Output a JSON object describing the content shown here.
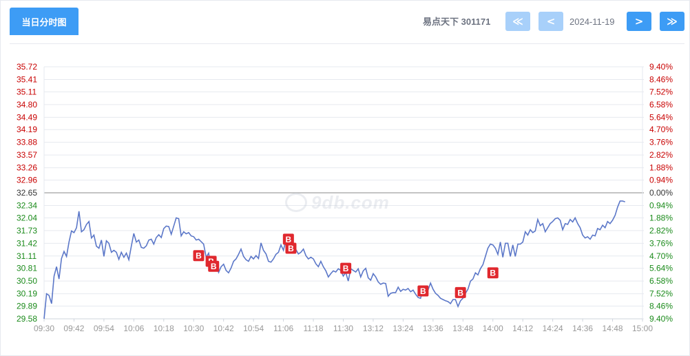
{
  "tab": {
    "label": "当日分时图"
  },
  "stock": {
    "name": "易点天下",
    "code": "301171"
  },
  "date": "2024-11-19",
  "nav": {
    "first": "≪",
    "prev": "<",
    "next": ">",
    "last": "≫"
  },
  "watermark": {
    "text": "9db.com"
  },
  "colors": {
    "line": "#5b77c8",
    "up": "#c80000",
    "down": "#1a8a1a",
    "base": "#333333",
    "grid": "#e6e9ef",
    "axis": "#999999",
    "marker": "#e0282e",
    "accent": "#3d9cf5"
  },
  "chart_data": {
    "type": "line",
    "base_price": 32.65,
    "y_ticks": [
      "35.72",
      "35.41",
      "35.11",
      "34.80",
      "34.49",
      "34.19",
      "33.88",
      "33.57",
      "33.26",
      "32.96",
      "32.65",
      "32.34",
      "32.04",
      "31.73",
      "31.42",
      "31.11",
      "30.81",
      "30.50",
      "30.19",
      "29.89",
      "29.58"
    ],
    "pct_ticks": [
      "9.40%",
      "8.46%",
      "7.52%",
      "6.58%",
      "5.64%",
      "4.70%",
      "3.76%",
      "2.82%",
      "1.88%",
      "0.94%",
      "0.00%",
      "0.94%",
      "1.88%",
      "2.82%",
      "3.76%",
      "4.70%",
      "5.64%",
      "6.58%",
      "7.52%",
      "8.46%",
      "9.40%"
    ],
    "x_ticks": [
      "09:30",
      "09:42",
      "09:54",
      "10:06",
      "10:18",
      "10:30",
      "10:42",
      "10:54",
      "11:06",
      "11:18",
      "11:30",
      "13:12",
      "13:24",
      "13:36",
      "13:48",
      "14:00",
      "14:12",
      "14:24",
      "14:36",
      "14:48",
      "15:00"
    ],
    "ylim": [
      29.58,
      35.72
    ],
    "session_minutes": 240,
    "x": [
      0,
      1,
      2,
      3,
      4,
      5,
      6,
      7,
      8,
      9,
      10,
      11,
      12,
      13,
      14,
      15,
      16,
      17,
      18,
      19,
      20,
      21,
      22,
      23,
      24,
      25,
      26,
      27,
      28,
      29,
      30,
      31,
      32,
      33,
      34,
      35,
      36,
      37,
      38,
      39,
      40,
      41,
      42,
      43,
      44,
      45,
      46,
      47,
      48,
      49,
      50,
      51,
      52,
      53,
      54,
      55,
      56,
      57,
      58,
      59,
      60,
      61,
      62,
      63,
      64,
      65,
      66,
      67,
      68,
      69,
      70,
      71,
      72,
      73,
      74,
      75,
      76,
      77,
      78,
      79,
      80,
      81,
      82,
      83,
      84,
      85,
      86,
      87,
      88,
      89,
      90,
      91,
      92,
      93,
      94,
      95,
      96,
      97,
      98,
      99,
      100,
      101,
      102,
      103,
      104,
      105,
      106,
      107,
      108,
      109,
      110,
      111,
      112,
      113,
      114,
      115,
      116,
      117,
      118,
      119,
      120,
      121,
      122,
      123,
      124,
      125,
      126,
      127,
      128,
      129,
      130,
      131,
      132,
      133,
      134,
      135,
      136,
      137,
      138,
      139,
      140,
      141,
      142,
      143,
      144,
      145,
      146,
      147,
      148,
      149,
      150,
      151,
      152,
      153,
      154,
      155,
      156,
      157,
      158,
      159,
      160,
      161,
      162,
      163,
      164,
      165,
      166,
      167,
      168,
      169,
      170,
      171,
      172,
      173,
      174,
      175,
      176,
      177,
      178,
      179,
      180,
      181,
      182,
      183,
      184,
      185,
      186,
      187,
      188,
      189,
      190,
      191,
      192,
      193,
      194,
      195,
      196,
      197,
      198,
      199,
      200,
      201,
      202,
      203,
      204,
      205,
      206,
      207,
      208,
      209,
      210,
      211,
      212,
      213,
      214,
      215,
      216,
      217,
      218,
      219,
      220,
      221,
      222,
      223,
      224,
      225,
      226,
      227,
      228,
      229,
      230,
      231,
      232,
      233,
      234,
      235,
      236,
      237,
      238,
      239,
      240
    ],
    "series": [
      {
        "values": [
          29.58,
          30.19,
          30.15,
          29.95,
          30.62,
          30.85,
          30.55,
          31.05,
          31.22,
          31.1,
          31.45,
          31.72,
          31.68,
          31.8,
          32.2,
          31.7,
          31.75,
          31.88,
          31.95,
          31.55,
          31.62,
          31.35,
          31.3,
          31.5,
          31.1,
          31.48,
          31.42,
          31.2,
          31.25,
          31.2,
          31.03,
          31.2,
          31.08,
          31.18,
          31.02,
          31.35,
          31.66,
          31.45,
          31.5,
          31.32,
          31.3,
          31.36,
          31.5,
          31.52,
          31.4,
          31.56,
          31.63,
          31.56,
          31.78,
          31.84,
          31.83,
          31.64,
          31.84,
          32.04,
          32.02,
          31.6,
          31.7,
          31.65,
          31.68,
          31.6,
          31.58,
          31.5,
          31.52,
          31.46,
          31.4,
          31.08,
          31.18,
          30.81,
          30.95,
          30.88,
          30.71,
          30.85,
          30.91,
          30.76,
          30.7,
          30.82,
          30.98,
          31.04,
          31.15,
          31.28,
          31.1,
          31.02,
          30.98,
          31.1,
          31.04,
          31.12,
          31.05,
          31.43,
          31.25,
          31.16,
          30.98,
          30.96,
          31.04,
          31.15,
          31.2,
          31.38,
          31.25,
          31.5,
          31.42,
          31.48,
          31.22,
          31.27,
          31.16,
          31.2,
          31.28,
          31.12,
          31.04,
          31.08,
          31.04,
          30.92,
          30.85,
          30.98,
          30.85,
          30.75,
          30.6,
          30.68,
          30.75,
          30.72,
          30.8,
          30.76,
          30.62,
          30.71,
          30.5,
          30.8,
          30.76,
          30.72,
          30.8,
          30.6,
          30.75,
          30.81,
          30.58,
          30.52,
          30.68,
          30.6,
          30.48,
          30.42,
          30.45,
          30.44,
          30.13,
          30.2,
          30.22,
          30.22,
          30.35,
          30.25,
          30.3,
          30.28,
          30.32,
          30.24,
          30.28,
          30.18,
          30.1,
          30.08,
          30.3,
          30.25,
          30.28,
          30.45,
          30.3,
          30.2,
          30.15,
          30.08,
          30.05,
          30.02,
          30.0,
          29.95,
          30.05,
          30.05,
          29.88,
          30.02,
          30.08,
          30.2,
          30.3,
          30.5,
          30.55,
          30.7,
          30.65,
          30.8,
          30.9,
          31.1,
          31.3,
          31.4,
          31.38,
          31.3,
          31.15,
          31.45,
          31.08,
          31.42,
          31.42,
          31.1,
          31.38,
          31.1,
          31.4,
          31.4,
          31.45,
          31.7,
          31.62,
          31.75,
          31.68,
          31.72,
          32.0,
          31.85,
          31.9,
          31.7,
          31.8,
          31.9,
          31.95,
          32.02,
          32.04,
          31.98,
          31.75,
          31.9,
          31.88,
          32.0,
          31.94,
          32.04,
          31.9,
          31.8,
          31.62,
          31.55,
          31.58,
          31.52,
          31.62,
          31.6,
          31.78,
          31.75,
          31.86,
          31.8,
          31.95,
          31.9,
          31.98,
          32.1,
          32.3,
          32.45,
          32.45,
          32.43
        ]
      }
    ],
    "markers": [
      {
        "label": "B",
        "x": 62,
        "y": 31.12
      },
      {
        "label": "B",
        "x": 67,
        "y": 30.98
      },
      {
        "label": "B",
        "x": 68,
        "y": 30.86
      },
      {
        "label": "B",
        "x": 98,
        "y": 31.52
      },
      {
        "label": "B",
        "x": 99,
        "y": 31.3
      },
      {
        "label": "B",
        "x": 121,
        "y": 30.81
      },
      {
        "label": "B",
        "x": 152,
        "y": 30.26
      },
      {
        "label": "B",
        "x": 167,
        "y": 30.22
      },
      {
        "label": "B",
        "x": 180,
        "y": 30.7
      }
    ]
  }
}
